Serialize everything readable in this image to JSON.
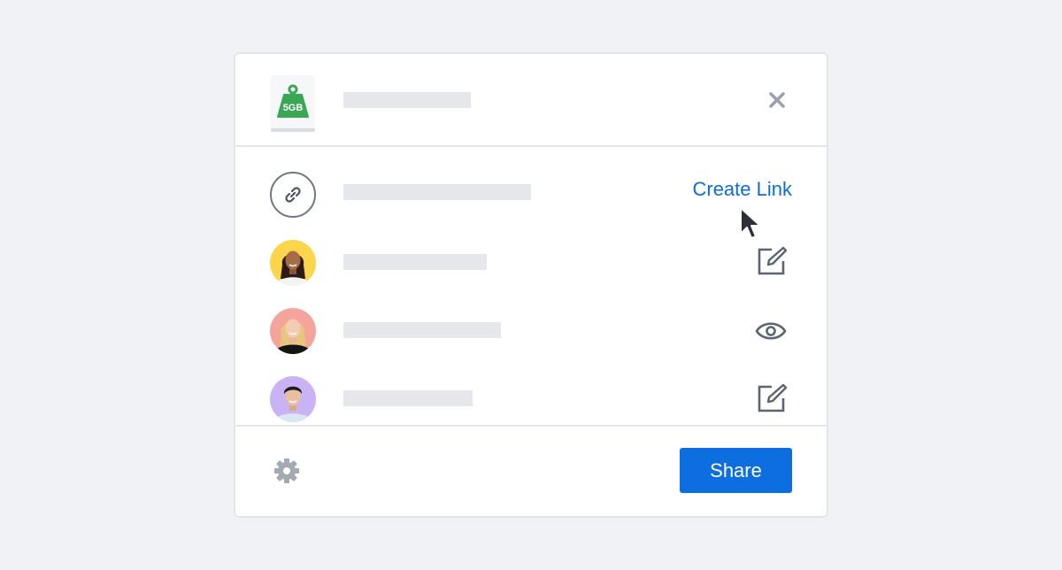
{
  "file": {
    "icon": "weight-icon",
    "size_label": "5GB",
    "accent_color": "#3aa757"
  },
  "header": {
    "close_icon": "close-icon"
  },
  "link_row": {
    "icon": "link-icon",
    "action_label": "Create Link",
    "action_color": "#0d6ed1"
  },
  "people": [
    {
      "avatar_bg": "#fbd54b",
      "permission_icon": "edit-icon"
    },
    {
      "avatar_bg": "#f5a49b",
      "permission_icon": "eye-icon"
    },
    {
      "avatar_bg": "#c9b3f5",
      "permission_icon": "edit-icon"
    }
  ],
  "footer": {
    "settings_icon": "gear-icon",
    "share_label": "Share",
    "share_color": "#0d6ee0"
  }
}
